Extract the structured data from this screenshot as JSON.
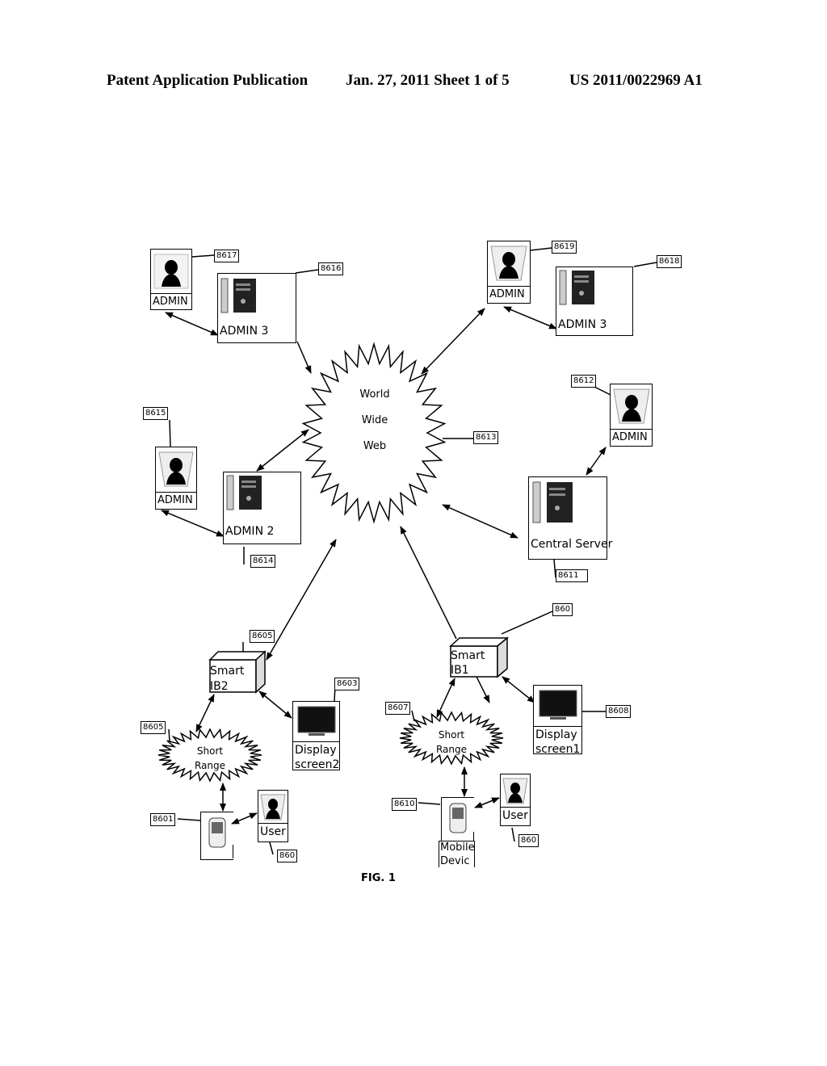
{
  "header": {
    "publication": "Patent Application Publication",
    "date_sheet": "Jan. 27, 2011   Sheet 1 of 5",
    "patent_number": "US 2011/0022969 A1"
  },
  "figure": {
    "caption": "FIG. 1",
    "web": {
      "lines": [
        "World",
        "Wide",
        "Web"
      ],
      "ref": "8613"
    },
    "nodes": {
      "admin_tl": {
        "label": "ADMIN",
        "ref": "8617"
      },
      "server_tl": {
        "label": "ADMIN 3",
        "ref": "8616"
      },
      "admin_tr": {
        "label": "ADMIN",
        "ref": "8619"
      },
      "server_tr": {
        "label": "ADMIN 3",
        "ref": "8618"
      },
      "admin_ml": {
        "label": "ADMIN",
        "ref": "8615"
      },
      "server_ml": {
        "label": "ADMIN 2",
        "ref": "8614"
      },
      "admin_mr": {
        "label": "ADMIN",
        "ref": "8612"
      },
      "central_server": {
        "label": "Central Server",
        "ref": "8611"
      },
      "smart_ib2": {
        "label_line1": "Smart",
        "label_line2": "IB2",
        "ref": "8605"
      },
      "display2": {
        "label_line1": "Display",
        "label_line2": "screen2",
        "ref": "8603"
      },
      "short_range_left": {
        "label_line1": "Short",
        "label_line2": "Range",
        "ref": "8605"
      },
      "mobile_left": {
        "ref": "8601"
      },
      "user_left": {
        "label": "User",
        "ref": "860"
      },
      "smart_ib1": {
        "label_line1": "Smart",
        "label_line2": "IB1",
        "ref": "860"
      },
      "display1": {
        "label_line1": "Display",
        "label_line2": "screen1",
        "ref": "8608"
      },
      "short_range_right": {
        "label_line1": "Short",
        "label_line2": "Range",
        "ref": "8607"
      },
      "mobile_right": {
        "label_line1": "Mobile",
        "label_line2": "Devic",
        "ref": "8610"
      },
      "user_right": {
        "label": "User",
        "ref": "860"
      }
    }
  }
}
